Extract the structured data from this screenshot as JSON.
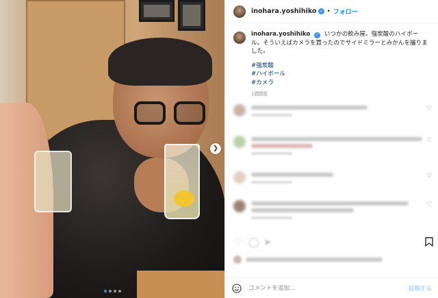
{
  "header": {
    "username": "inohara.yoshihiko",
    "separator": "•",
    "follow_label": "フォロー"
  },
  "caption": {
    "username": "inohara.yoshihiko",
    "text": "いつかの飲み屋。強炭酸のハイボール。そういえばカメラを買ったのでサイドミラーとみかんを撮りました。",
    "hashtags": [
      "#強炭酸",
      "#ハイボール",
      "#カメラ"
    ],
    "time": "1週間前"
  },
  "comment_bar": {
    "placeholder": "コメントを追加...",
    "post_label": "投稿する"
  },
  "carousel": {
    "total_slides": 4,
    "active_slide": 1
  },
  "icons": {
    "verified": "verified-badge-icon",
    "next": "chevron-right-icon",
    "heart": "heart-icon",
    "bookmark": "bookmark-icon",
    "emoji": "emoji-icon"
  },
  "colors": {
    "accent": "#0095f6",
    "verified": "#3797f0",
    "hashtag": "#00376b",
    "post_disabled": "#b3dbff"
  }
}
